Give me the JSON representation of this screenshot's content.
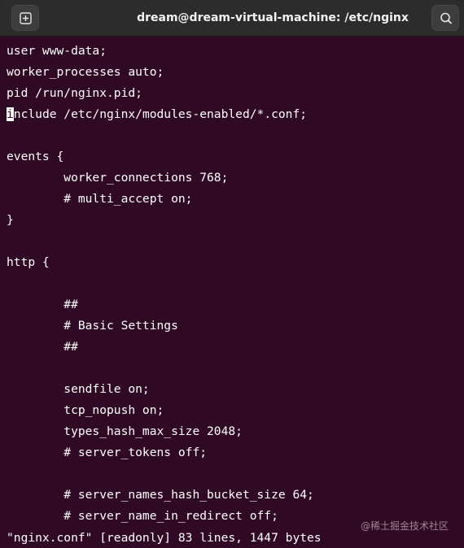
{
  "window": {
    "title": "dream@dream-virtual-machine: /etc/nginx"
  },
  "toolbar": {
    "new_tab_icon": "new-tab-icon",
    "search_icon": "search-icon"
  },
  "terminal": {
    "lines": [
      "user www-data;",
      "worker_processes auto;",
      "pid /run/nginx.pid;",
      "include /etc/nginx/modules-enabled/*.conf;",
      "",
      "events {",
      "        worker_connections 768;",
      "        # multi_accept on;",
      "}",
      "",
      "http {",
      "",
      "        ##",
      "        # Basic Settings",
      "        ##",
      "",
      "        sendfile on;",
      "        tcp_nopush on;",
      "        types_hash_max_size 2048;",
      "        # server_tokens off;",
      "",
      "        # server_names_hash_bucket_size 64;",
      "        # server_name_in_redirect off;"
    ],
    "cursor_char": "i",
    "cursor_line_rest": "nclude /etc/nginx/modules-enabled/*.conf;",
    "status_line": "\"nginx.conf\" [readonly] 83 lines, 1447 bytes"
  },
  "watermark": "@稀土掘金技术社区",
  "colors": {
    "terminal_bg": "#300a24",
    "titlebar_bg": "#2c2c2c",
    "text": "#ffffff"
  }
}
